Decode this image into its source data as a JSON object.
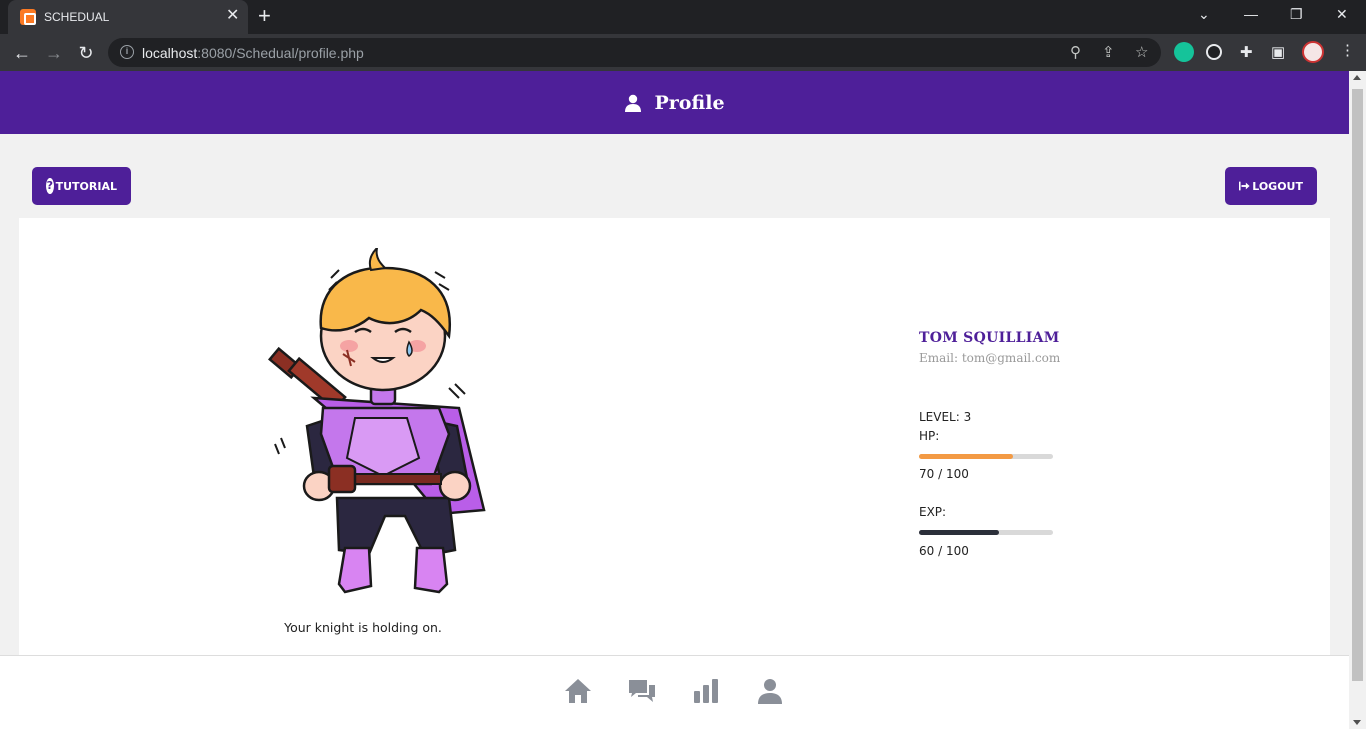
{
  "browser": {
    "tab_title": "SCHEDUAL",
    "url_host": "localhost",
    "url_rest": ":8080/Schedual/profile.php"
  },
  "header": {
    "title": "Profile"
  },
  "buttons": {
    "tutorial": "TUTORIAL",
    "logout": "LOGOUT"
  },
  "profile": {
    "name": "TOM SQUILLIAM",
    "email": "Email: tom@gmail.com",
    "level_label": "LEVEL: 3",
    "hp_label": "HP:",
    "hp_text": "70 / 100",
    "hp_fraction": 0.7,
    "exp_label": "EXP:",
    "exp_text": "60 / 100",
    "exp_fraction": 0.6,
    "caption": "Your knight is holding on."
  },
  "colors": {
    "brand": "#4e1f99",
    "hp_bar": "#f39a44",
    "exp_bar": "#2b2f3a",
    "nav_icon": "#8a8f98"
  },
  "bottom_nav": [
    "home-icon",
    "chat-icon",
    "stats-icon",
    "profile-icon"
  ]
}
